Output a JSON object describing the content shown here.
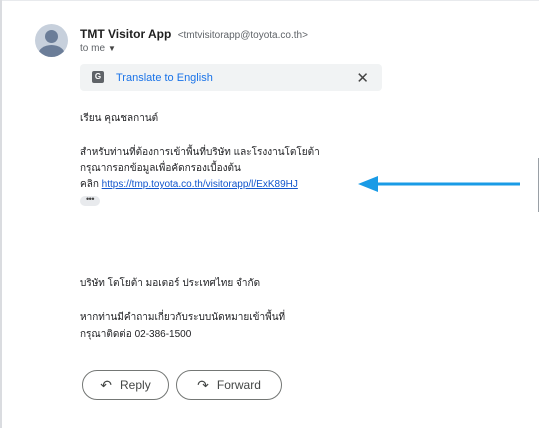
{
  "sender": {
    "name": "TMT Visitor App",
    "address": "<tmtvisitorapp@toyota.co.th>",
    "to_label": "to me"
  },
  "translate": {
    "label": "Translate to English"
  },
  "email": {
    "greeting": "เรียน คุณชลกานต์",
    "line1": "สำหรับท่านที่ต้องการเข้าพื้นที่บริษัท และโรงงานโตโยต้า",
    "line2": "กรุณากรอกข้อมูลเพื่อคัดกรองเบื้องต้น",
    "click_prefix": "คลิก",
    "link": "https://tmp.toyota.co.th/visitorapp/l/ExK89HJ",
    "ellipsis": "•••",
    "company": "บริษัท โตโยต้า มอเตอร์ ประเทศไทย จำกัด",
    "contact_line1": "หากท่านมีคำถามเกี่ยวกับระบบนัดหมายเข้าพื้นที่",
    "contact_line2": "กรุณาติดต่อ 02-386-1500"
  },
  "actions": {
    "reply": "Reply",
    "forward": "Forward"
  },
  "colors": {
    "link": "#1155cc",
    "translate_link": "#1a73e8",
    "annotation_arrow": "#1a9be6"
  },
  "icons": {
    "translate": "translate-icon",
    "close": "close-icon",
    "reply": "reply-icon",
    "forward": "forward-icon"
  }
}
